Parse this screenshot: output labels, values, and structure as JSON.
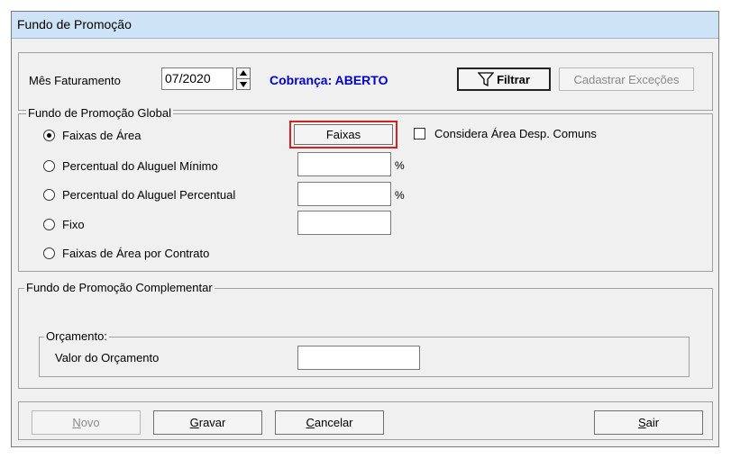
{
  "window": {
    "title": "Fundo de Promoção"
  },
  "header": {
    "mes_label": "Mês Faturamento",
    "mes_value": "07/2020",
    "cobranca": "Cobrança: ABERTO",
    "filtrar": "Filtrar",
    "cadastrar": "Cadastrar Exceções"
  },
  "global": {
    "legend": "Fundo de Promoção Global",
    "options": [
      {
        "label": "Faixas de Área",
        "selected": true
      },
      {
        "label": "Percentual do Aluguel Mínimo",
        "selected": false
      },
      {
        "label": "Percentual do Aluguel Percentual",
        "selected": false
      },
      {
        "label": "Fixo",
        "selected": false
      },
      {
        "label": "Faixas de Área por Contrato",
        "selected": false
      }
    ],
    "faixas_button": "Faixas",
    "considera_label": "Considera Área Desp. Comuns",
    "percent_symbol": "%"
  },
  "complementar": {
    "legend": "Fundo de Promoção Complementar",
    "orcamento_legend": "Orçamento:",
    "valor_label": "Valor do Orçamento"
  },
  "footer": {
    "novo_first": "N",
    "novo_rest": "ovo",
    "gravar_first": "G",
    "gravar_rest": "ravar",
    "cancelar_first": "C",
    "cancelar_rest": "ancelar",
    "sair_first": "S",
    "sair_rest": "air"
  },
  "colors": {
    "accent_blue": "#0000cc",
    "highlight_red": "#d62020"
  }
}
